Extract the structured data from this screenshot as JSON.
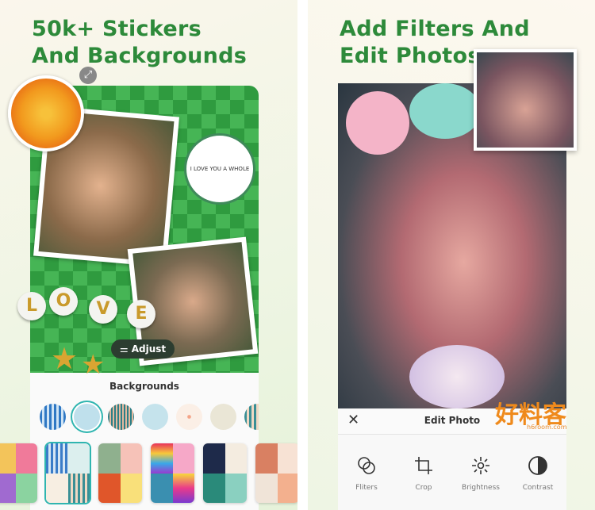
{
  "left": {
    "title_line1": "50k+ Stickers",
    "title_line2": "And Backgrounds",
    "sticker_text": "I LOVE YOU A WHOLE",
    "love_letters": [
      "L",
      "O",
      "V",
      "E"
    ],
    "adjust_label": "Adjust",
    "backgrounds_label": "Backgrounds",
    "background_circles": [
      "#4a90d0",
      "#bfe0ec",
      "#2d7f86",
      "#bfe1ea",
      "#fbefe6",
      "#f2ece0",
      "#3a8f95"
    ],
    "selected_circle": 1,
    "accent": "#2fb5b0"
  },
  "right": {
    "title_line1": "Add Filters And",
    "title_line2": "Edit Photos",
    "edit_title": "Edit Photo",
    "tools": [
      {
        "label": "Fliters",
        "icon": "filters-icon"
      },
      {
        "label": "Crop",
        "icon": "crop-icon"
      },
      {
        "label": "Brightness",
        "icon": "brightness-icon"
      },
      {
        "label": "Contrast",
        "icon": "contrast-icon"
      }
    ],
    "watermark": "好料客 h6room.com"
  },
  "title_color": "#2d8a3a"
}
